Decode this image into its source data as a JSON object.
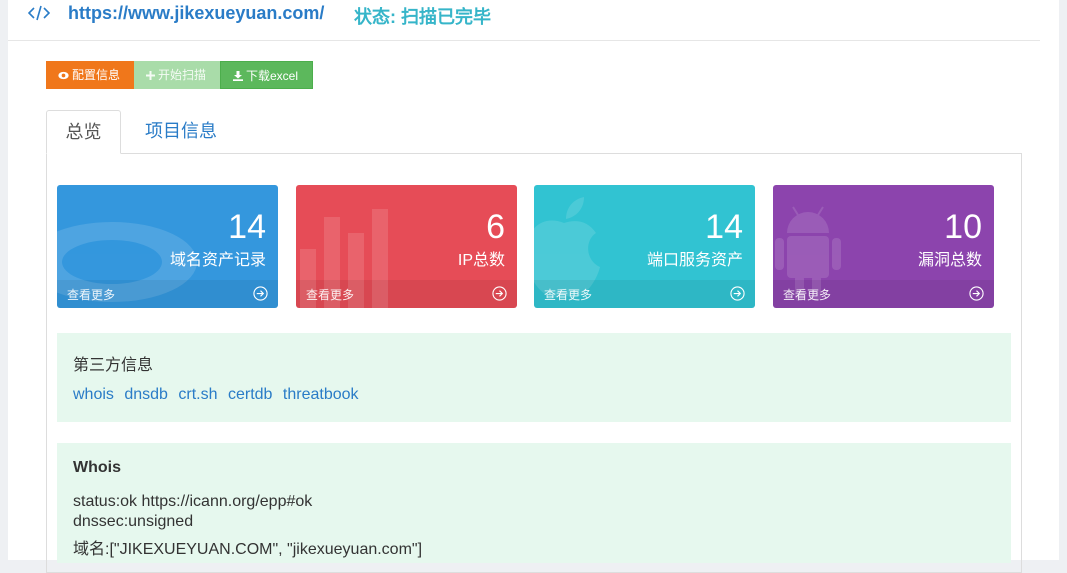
{
  "header": {
    "url": "https://www.jikexueyuan.com/",
    "status": "状态: 扫描已完毕",
    "url_color": "#2a7cc7",
    "status_color": "#36b5c9"
  },
  "toolbar": {
    "config_label": "配置信息",
    "start_scan_label": "开始扫描",
    "download_label": "下载excel"
  },
  "tabs": [
    {
      "label": "总览",
      "active": true
    },
    {
      "label": "项目信息",
      "active": false
    }
  ],
  "stats": [
    {
      "value": "14",
      "label": "域名资产记录",
      "more": "查看更多",
      "color": "#3497dd",
      "icon": "chat-bubble-icon"
    },
    {
      "value": "6",
      "label": "IP总数",
      "more": "查看更多",
      "color": "#e64c57",
      "icon": "bar-chart-icon"
    },
    {
      "value": "14",
      "label": "端口服务资产",
      "more": "查看更多",
      "color": "#31c3d2",
      "icon": "apple-icon"
    },
    {
      "value": "10",
      "label": "漏洞总数",
      "more": "查看更多",
      "color": "#8c44ad",
      "icon": "android-icon"
    }
  ],
  "third_party": {
    "title": "第三方信息",
    "links": [
      "whois",
      "dnsdb",
      "crt.sh",
      "certdb",
      "threatbook"
    ]
  },
  "whois": {
    "title": "Whois",
    "lines": [
      "status:ok https://icann.org/epp#ok",
      "dnssec:unsigned",
      "域名:[\"JIKEXUEYUAN.COM\", \"jikexueyuan.com\"]"
    ]
  }
}
